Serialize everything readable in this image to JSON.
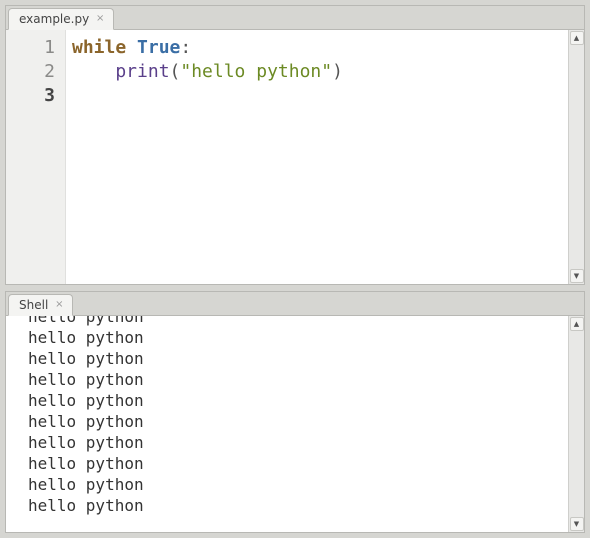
{
  "editor": {
    "tab_label": "example.py",
    "lines": [
      {
        "n": "1",
        "indent": false,
        "tokens": [
          {
            "cls": "tok-kw",
            "t": "while"
          },
          {
            "cls": "",
            "t": " "
          },
          {
            "cls": "tok-const",
            "t": "True"
          },
          {
            "cls": "tok-punc",
            "t": ":"
          }
        ]
      },
      {
        "n": "2",
        "indent": true,
        "tokens": [
          {
            "cls": "tok-func",
            "t": "print"
          },
          {
            "cls": "tok-punc",
            "t": "("
          },
          {
            "cls": "tok-str",
            "t": "\"hello python\""
          },
          {
            "cls": "tok-punc",
            "t": ")"
          }
        ]
      },
      {
        "n": "3",
        "indent": false,
        "current": true,
        "tokens": []
      }
    ]
  },
  "shell": {
    "tab_label": "Shell",
    "output_line": "hello python",
    "visible_lines": 10
  },
  "icons": {
    "close": "×",
    "up": "▲",
    "down": "▼"
  }
}
